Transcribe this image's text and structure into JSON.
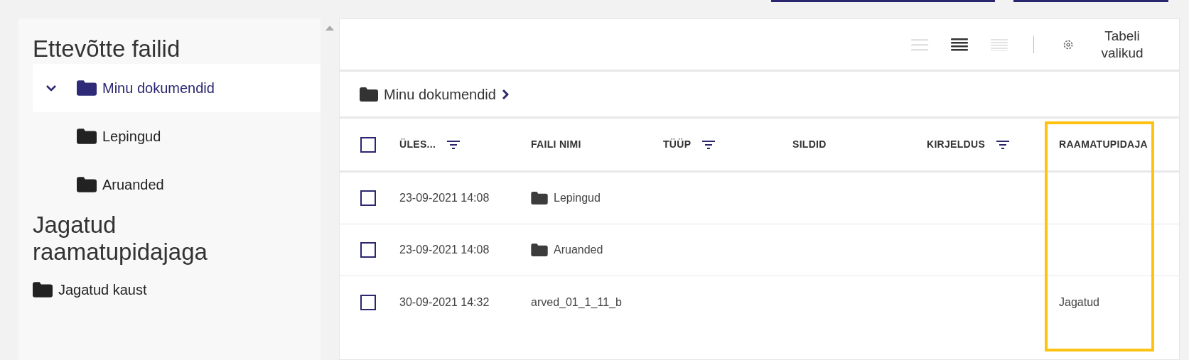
{
  "sidebar": {
    "sections": [
      {
        "title": "Ettevõtte failid",
        "items": [
          {
            "label": "Minu dokumendid",
            "selected": true,
            "expanded": true,
            "children": [
              {
                "label": "Lepingud",
                "selected": false
              },
              {
                "label": "Aruanded",
                "selected": false
              }
            ]
          }
        ]
      },
      {
        "title": "Jagatud raamatupidajaga",
        "items": [
          {
            "label": "Jagatud kaust",
            "selected": false
          }
        ]
      }
    ]
  },
  "toolbar": {
    "view_modes": [
      {
        "kind": "sparse",
        "selected": false
      },
      {
        "kind": "normal",
        "selected": true
      },
      {
        "kind": "dense",
        "selected": false
      }
    ],
    "table_options": "Tabeli valikud"
  },
  "breadcrumb": [
    "Minu dokumendid"
  ],
  "table": {
    "select_all_checked": false,
    "columns": [
      {
        "label": "ÜLES...",
        "filter": true,
        "highlighted": false
      },
      {
        "label": "FAILI NIMI",
        "filter": false,
        "highlighted": false
      },
      {
        "label": "TÜÜP",
        "filter": true,
        "highlighted": false
      },
      {
        "label": "SILDID",
        "filter": false,
        "highlighted": false
      },
      {
        "label": "KIRJELDUS",
        "filter": true,
        "highlighted": false
      },
      {
        "label": "RAAMATUPIDAJA",
        "filter": false,
        "highlighted": true
      }
    ],
    "rows": [
      {
        "checked": false,
        "uploaded": "23-09-2021 14:08",
        "name": "Lepingud",
        "kind": "folder"
      },
      {
        "checked": false,
        "uploaded": "23-09-2021 14:08",
        "name": "Aruanded",
        "kind": "folder"
      },
      {
        "checked": false,
        "uploaded": "30-09-2021 14:32",
        "name": "arved_01_1_11_b",
        "kind": "file",
        "accountant": "Jagatud"
      }
    ]
  }
}
